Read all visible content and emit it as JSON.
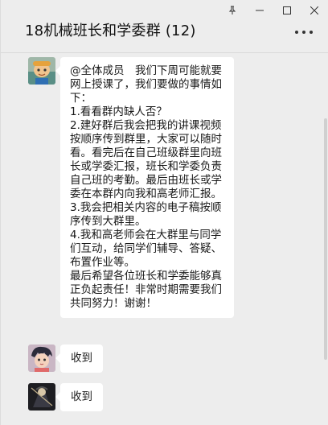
{
  "window": {
    "pin_icon": "pin-icon",
    "minimize_icon": "minimize-icon",
    "maximize_icon": "maximize-icon",
    "close_icon": "close-icon"
  },
  "chat": {
    "title": "18机械班长和学委群 (12)",
    "more_icon": "more-icon"
  },
  "messages": [
    {
      "avatar": "avatar-cartoon-icon",
      "text": "@全体成员　我们下周可能就要网上授课了，我们要做的事情如下：\n1.看看群内缺人否？\n2.建好群后我会把我的讲课视频按顺序传到群里，大家可以随时看。看完后在自己班级群里向班长或学委汇报，班长和学委负责自己班的考勤。最后由班长或学委在本群内向我和高老师汇报。\n3.我会把相关内容的电子稿按顺序传到大群里。\n4.我和高老师会在大群里与同学们互动，给同学们辅导、答疑、布置作业等。\n最后希望各位班长和学委能够真正负起责任！非常时期需要我们共同努力！谢谢！"
    },
    {
      "avatar": "avatar-anime-icon",
      "text": "收到"
    },
    {
      "avatar": "avatar-dark-icon",
      "text": "收到"
    }
  ],
  "colors": {
    "background": "#ededed",
    "bubble": "#ffffff"
  }
}
